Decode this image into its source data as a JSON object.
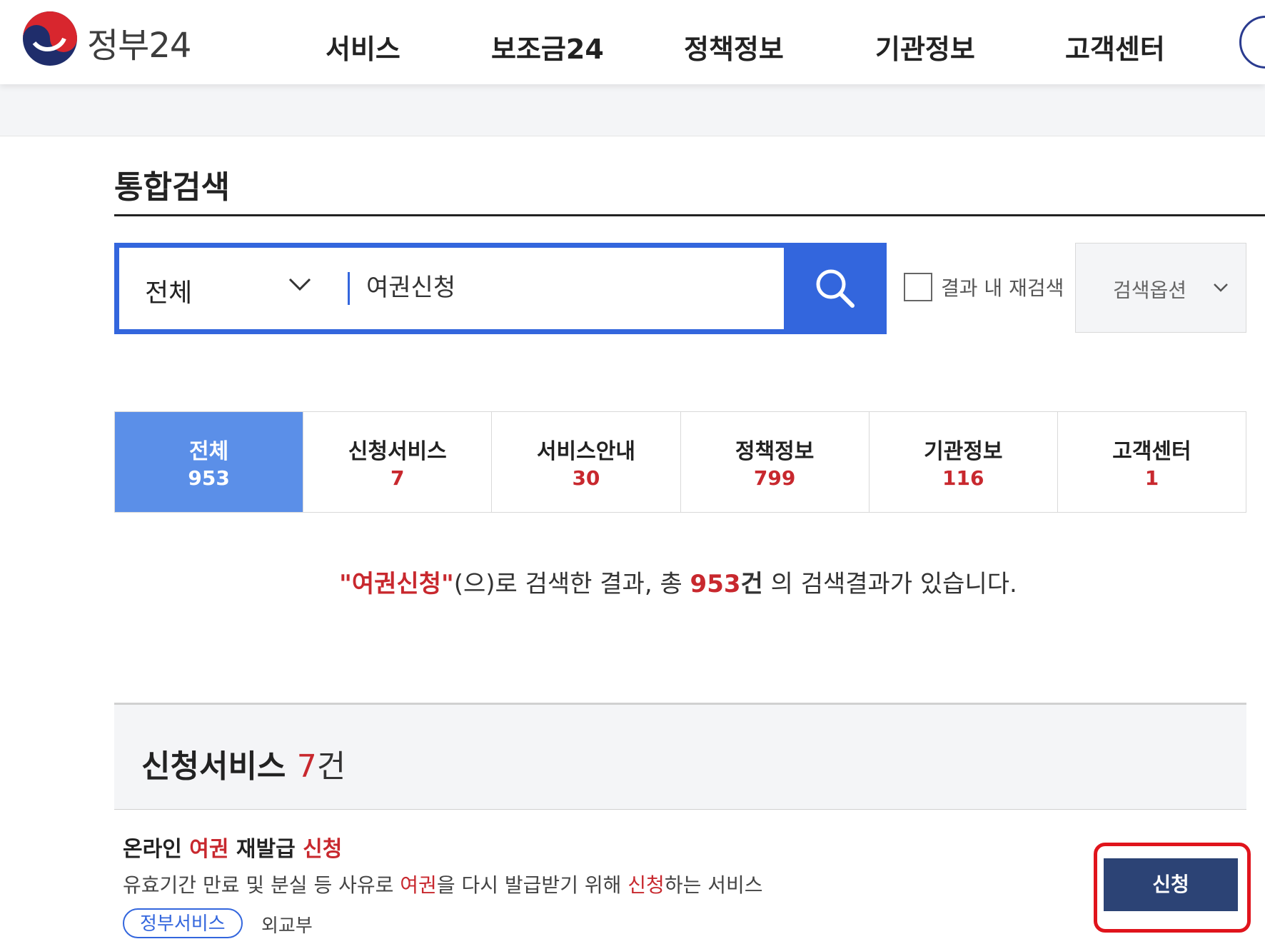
{
  "header": {
    "logo_text": "정부24",
    "nav": [
      "서비스",
      "보조금24",
      "정책정보",
      "기관정보",
      "고객센터"
    ]
  },
  "page": {
    "title": "통합검색"
  },
  "search": {
    "scope": "전체",
    "query": "여권신청",
    "re_search_label": "결과 내 재검색",
    "option_label": "검색옵션"
  },
  "tabs": [
    {
      "label": "전체",
      "count": "953",
      "active": true
    },
    {
      "label": "신청서비스",
      "count": "7"
    },
    {
      "label": "서비스안내",
      "count": "30"
    },
    {
      "label": "정책정보",
      "count": "799"
    },
    {
      "label": "기관정보",
      "count": "116"
    },
    {
      "label": "고객센터",
      "count": "1"
    }
  ],
  "summary": {
    "query_quoted": "\"여권신청\"",
    "part1": "(으)로 검색한 결과, 총 ",
    "total": "953",
    "unit": "건",
    "part2": " 의 검색결과가 있습니다."
  },
  "section": {
    "title": "신청서비스",
    "count": "7",
    "unit": "건"
  },
  "result": {
    "title_parts": [
      "온라인 ",
      "여권",
      " 재발급 ",
      "신청"
    ],
    "desc_parts": [
      "유효기간 만료 및 분실 등 사유로 ",
      "여권",
      "을 다시 발급받기 위해 ",
      "신청",
      "하는 서비스"
    ],
    "tag": "정부서비스",
    "org": "외교부",
    "apply_label": "신청"
  },
  "colors": {
    "brand_blue": "#3366dd",
    "active_tab": "#5b8fe8",
    "highlight_red": "#c8282e",
    "apply_navy": "#2c4375"
  }
}
